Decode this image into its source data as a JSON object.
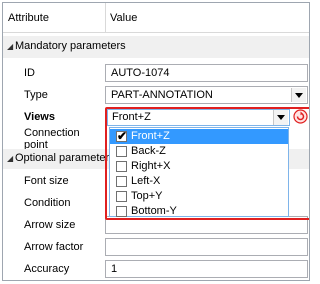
{
  "header": {
    "attribute": "Attribute",
    "value": "Value"
  },
  "groups": {
    "mandatory": "Mandatory parameters",
    "optional": "Optional parameters"
  },
  "rows": {
    "id": {
      "label": "ID",
      "value": "AUTO-1074"
    },
    "type": {
      "label": "Type",
      "value": "PART-ANNOTATION"
    },
    "views": {
      "label": "Views",
      "value": "Front+Z"
    },
    "connection_point": {
      "label_line1": "Connection",
      "label_line2": "point"
    },
    "font_size": {
      "label": "Font size"
    },
    "condition": {
      "label": "Condition"
    },
    "arrow_size": {
      "label": "Arrow size"
    },
    "arrow_factor": {
      "label": "Arrow factor"
    },
    "accuracy": {
      "label": "Accuracy",
      "value": "1"
    }
  },
  "views_options": [
    {
      "label": "Front+Z",
      "checked": true,
      "selected": true
    },
    {
      "label": "Back-Z",
      "checked": false,
      "selected": false
    },
    {
      "label": "Right+X",
      "checked": false,
      "selected": false
    },
    {
      "label": "Left-X",
      "checked": false,
      "selected": false
    },
    {
      "label": "Top+Y",
      "checked": false,
      "selected": false
    },
    {
      "label": "Bottom-Y",
      "checked": false,
      "selected": false
    }
  ],
  "colors": {
    "highlight": "#e02020",
    "selection": "#3399ff",
    "group_bg": "#f0f0f0"
  }
}
